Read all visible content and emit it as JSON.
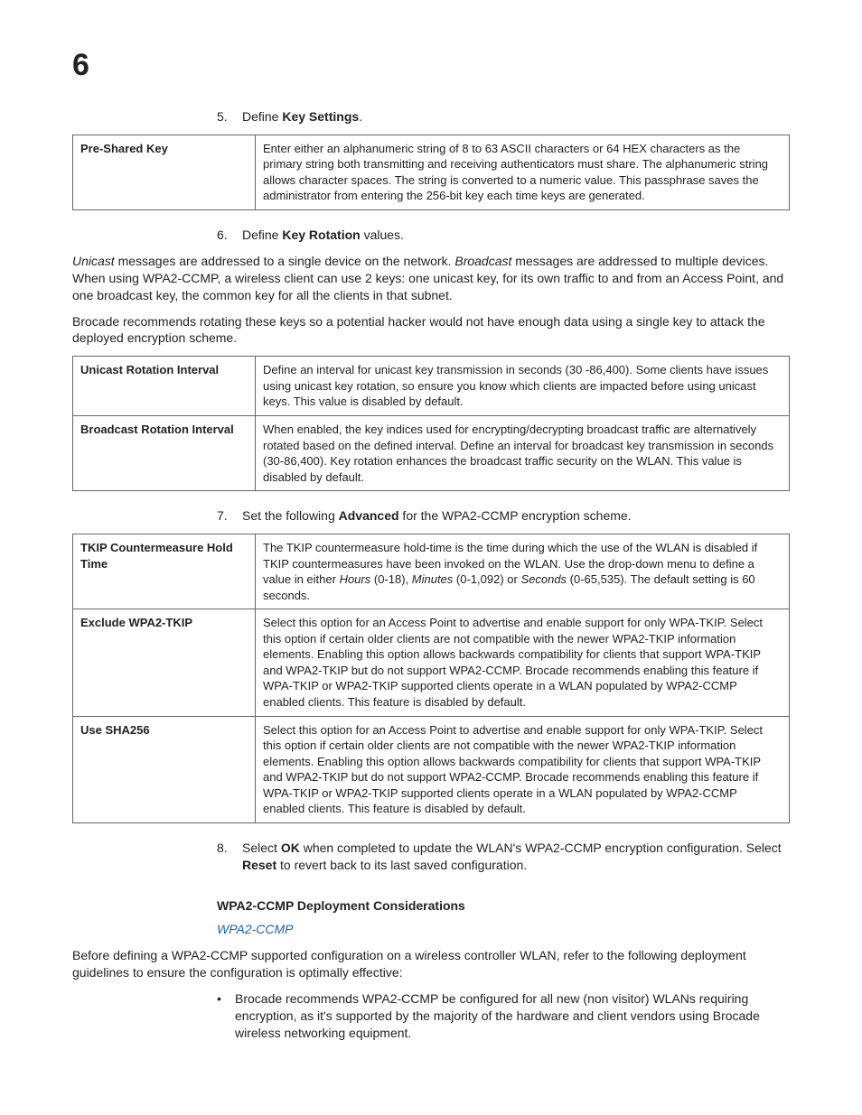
{
  "chapter": "6",
  "step5": {
    "num": "5.",
    "pre": "Define ",
    "bold": "Key Settings",
    "post": "."
  },
  "table1": {
    "r1": {
      "label": "Pre-Shared Key",
      "desc": "Enter either an alphanumeric string of 8 to 63 ASCII characters or 64 HEX characters as the primary string both transmitting and receiving authenticators must share. The alphanumeric string allows character spaces. The string is converted to a numeric value. This passphrase saves the administrator from entering the 256-bit key each time keys are generated."
    }
  },
  "step6": {
    "num": "6.",
    "pre": "Define ",
    "bold": "Key Rotation",
    "post": " values."
  },
  "p6a": {
    "i1": "Unicast",
    "t1": " messages are addressed to a single device on the network. ",
    "i2": "Broadcast",
    "t2": " messages are addressed to multiple devices. When using WPA2-CCMP, a wireless client can use 2 keys: one unicast key, for its own traffic to and from an Access Point, and one broadcast key, the common key for all the clients in that subnet."
  },
  "p6b": "Brocade recommends rotating these keys so a potential hacker would not have enough data using a single key to attack the deployed encryption scheme.",
  "table2": {
    "r1": {
      "label": "Unicast Rotation Interval",
      "desc": "Define an interval for unicast key transmission in seconds (30 -86,400). Some clients have issues using unicast key rotation, so ensure you know which clients are impacted before using unicast keys. This value is disabled by default."
    },
    "r2": {
      "label": "Broadcast Rotation Interval",
      "desc": "When enabled, the key indices used for encrypting/decrypting broadcast traffic are alternatively rotated based on the defined interval. Define an interval for broadcast key transmission in seconds (30-86,400). Key rotation enhances the broadcast traffic security on the WLAN. This value is disabled by default."
    }
  },
  "step7": {
    "num": "7.",
    "pre": "Set the following ",
    "bold": "Advanced",
    "post": " for the WPA2-CCMP encryption scheme."
  },
  "table3": {
    "r1": {
      "label": "TKIP Countermeasure Hold Time",
      "d_pre": "The TKIP countermeasure hold-time is the time during which the use of the WLAN is disabled if TKIP countermeasures have been invoked on the WLAN. Use the drop-down menu to define a value in either ",
      "d_i1": "Hours",
      "d_m1": " (0-18), ",
      "d_i2": "Minutes",
      "d_m2": " (0-1,092) or ",
      "d_i3": "Seconds",
      "d_post": " (0-65,535). The default setting is 60 seconds."
    },
    "r2": {
      "label": "Exclude WPA2-TKIP",
      "desc": "Select this option for an Access Point to advertise and enable support for only WPA-TKIP. Select this option if certain older clients are not compatible with the newer WPA2-TKIP information elements. Enabling this option allows backwards compatibility for clients that support WPA-TKIP and WPA2-TKIP but do not support WPA2-CCMP. Brocade recommends enabling this feature if WPA-TKIP or WPA2-TKIP supported clients operate in a WLAN populated by WPA2-CCMP enabled clients. This feature is disabled by default."
    },
    "r3": {
      "label": "Use SHA256",
      "desc": "Select this option for an Access Point to advertise and enable support for only WPA-TKIP. Select this option if certain older clients are not compatible with the newer WPA2-TKIP information elements. Enabling this option allows backwards compatibility for clients that support WPA-TKIP and WPA2-TKIP but do not support WPA2-CCMP. Brocade recommends enabling this feature if WPA-TKIP or WPA2-TKIP supported clients operate in a WLAN populated by WPA2-CCMP enabled clients. This feature is disabled by default."
    }
  },
  "step8": {
    "num": "8.",
    "pre": "Select ",
    "b1": "OK",
    "mid": " when completed to update the WLAN's WPA2-CCMP encryption configuration. Select ",
    "b2": "Reset",
    "post": " to revert back to its last saved configuration."
  },
  "sectionHead": "WPA2-CCMP Deployment Considerations",
  "link": "WPA2-CCMP",
  "pDeploy": "Before defining a WPA2-CCMP supported configuration on a wireless controller WLAN, refer to the following deployment guidelines to ensure the configuration is optimally effective:",
  "bullet1": "Brocade recommends WPA2-CCMP be configured for all new (non visitor) WLANs requiring encryption, as it's supported by the majority of the hardware and client vendors using Brocade wireless networking equipment."
}
